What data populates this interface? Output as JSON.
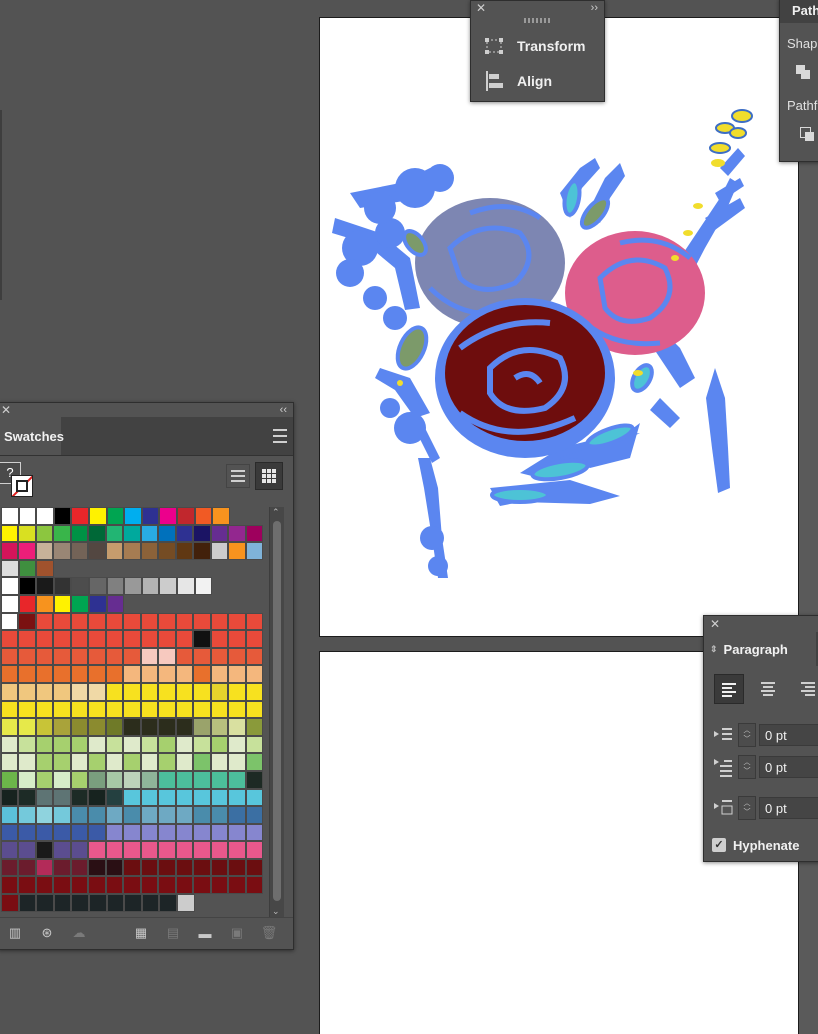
{
  "panels": {
    "transform_align": {
      "items": [
        {
          "label": "Transform",
          "icon": "transform-icon"
        },
        {
          "label": "Align",
          "icon": "align-icon"
        }
      ]
    },
    "pathfinder": {
      "tab_label": "Path",
      "shape_label": "Shap",
      "pathfinder_label": "Pathf"
    },
    "swatches": {
      "tab_label": "Swatches",
      "help_label": "?",
      "views": [
        "list-view",
        "grid-view"
      ],
      "colors": {
        "accent_selected": "#ffffff",
        "panel_bg": "#535353"
      }
    },
    "paragraph": {
      "tab_label": "Paragraph",
      "alignments": [
        "align-left",
        "align-center",
        "align-right"
      ],
      "fields": [
        {
          "name": "left-indent",
          "value": "0 pt"
        },
        {
          "name": "first-line-indent",
          "value": "0 pt"
        },
        {
          "name": "space-before",
          "value": "0 pt"
        }
      ],
      "hyphenate_label": "Hyphenate",
      "hyphenate_checked": true
    }
  },
  "artwork": {
    "palette": {
      "blue": "#5b86f0",
      "lavender": "#7d86b2",
      "pink": "#dd5d8c",
      "maroon": "#6e0d0d",
      "leaf": "#7c9a6a",
      "yellow": "#f1dd2c",
      "cyan": "#4dc3d6"
    }
  },
  "swatch_rows": [
    [
      "#ffffff",
      "#ffffff",
      "#ffffff",
      "#000000",
      "#e8262a",
      "#fff200",
      "#00a551",
      "#00aeef",
      "#2e3192",
      "#ec008c",
      "#c1272d",
      "#f15a24",
      "#f7931e"
    ],
    [
      "#fff200",
      "#d9e021",
      "#8cc63f",
      "#39b54a",
      "#009245",
      "#006837",
      "#22b573",
      "#00a99d",
      "#29abe2",
      "#0071bc",
      "#2e3192",
      "#1b1464",
      "#662d91",
      "#93278f",
      "#9e005d"
    ],
    [
      "#d4145a",
      "#ed1e79",
      "#c7b299",
      "#998675",
      "#736357",
      "#534741",
      "#c69c6d",
      "#a67c52",
      "#8c6239",
      "#754c24",
      "#603813",
      "#42210b",
      "#cccccc",
      "#f7931e",
      "#7fb3d9"
    ],
    [
      "#dddddd",
      "#3f8f3f",
      "#a0522d"
    ],
    [
      "#ffffff",
      "#000000",
      "#1a1a1a",
      "#333333",
      "#4d4d4d",
      "#666666",
      "#808080",
      "#999999",
      "#b3b3b3",
      "#cccccc",
      "#e6e6e6",
      "#f2f2f2"
    ],
    [
      "#ffffff",
      "#e8262a",
      "#f7931e",
      "#fff200",
      "#00a551",
      "#2e3192",
      "#662d91"
    ],
    [
      "#ffffff",
      "#7a1111",
      "#e84a3a",
      "#e84a3a",
      "#e84a3a",
      "#e84a3a",
      "#e84a3a",
      "#e84a3a",
      "#e84a3a",
      "#e84a3a",
      "#e84a3a",
      "#e84a3a",
      "#e84a3a",
      "#e84a3a",
      "#e84a3a"
    ],
    [
      "#e84a3a",
      "#e84a3a",
      "#e84a3a",
      "#e84a3a",
      "#e84a3a",
      "#e84a3a",
      "#e84a3a",
      "#e84a3a",
      "#e84a3a",
      "#e84a3a",
      "#e84a3a",
      "#111111",
      "#e84a3a",
      "#e84a3a",
      "#e84a3a"
    ],
    [
      "#e65a3a",
      "#e65a3a",
      "#e65a3a",
      "#e65a3a",
      "#e65a3a",
      "#e65a3a",
      "#e65a3a",
      "#e65a3a",
      "#f7c9bf",
      "#f7c9bf",
      "#e65a3a",
      "#e65a3a",
      "#e65a3a",
      "#e65a3a",
      "#e65a3a"
    ],
    [
      "#e8702c",
      "#e8702c",
      "#e8702c",
      "#e8702c",
      "#e8702c",
      "#e8702c",
      "#e8702c",
      "#f4b77d",
      "#f4b77d",
      "#f4b77d",
      "#f4b77d",
      "#e8702c",
      "#f4b77d",
      "#f4b77d",
      "#f4b77d"
    ],
    [
      "#f0c77e",
      "#f0c77e",
      "#f0c77e",
      "#f0c77e",
      "#f0d9a6",
      "#f0d9a6",
      "#f7e11f",
      "#f7e11f",
      "#f7e11f",
      "#f7e11f",
      "#f7e11f",
      "#f7e11f",
      "#e6d32c",
      "#f7e11f",
      "#f7e11f"
    ],
    [
      "#f7e11f",
      "#f7e11f",
      "#f7e11f",
      "#f7e11f",
      "#f7e11f",
      "#f7e11f",
      "#f7e11f",
      "#f7e11f",
      "#f7e11f",
      "#f7e11f",
      "#f7e11f",
      "#f7e11f",
      "#f7e11f",
      "#f7e11f",
      "#f7e11f"
    ],
    [
      "#e6e94a",
      "#e6e94a",
      "#c8c437",
      "#a9a33a",
      "#8b8b2f",
      "#8b8b2f",
      "#6f7a28",
      "#2c2d1c",
      "#2c2d1c",
      "#2c2d1c",
      "#2c2d1c",
      "#9aa36b",
      "#b8c07e",
      "#d9e0a0",
      "#8a9a3a"
    ],
    [
      "#dfeacb",
      "#c7e19b",
      "#a6d06e",
      "#a6d06e",
      "#a6d06e",
      "#dfeacb",
      "#c7e19b",
      "#dfeacb",
      "#c7e19b",
      "#a6d06e",
      "#dfeacb",
      "#c7e19b",
      "#a6d06e",
      "#dfeacb",
      "#c7e19b"
    ],
    [
      "#dfeacb",
      "#dfeacb",
      "#a6d06e",
      "#a6d06e",
      "#dfeacb",
      "#a6d06e",
      "#dfeacb",
      "#a6d06e",
      "#dfeacb",
      "#a6d06e",
      "#dfeacb",
      "#7cc36a",
      "#dfeacb",
      "#dfeacb",
      "#7cc36a"
    ],
    [
      "#6cb54a",
      "#d6ecc8",
      "#a6d06e",
      "#d6ecc8",
      "#a6d06e",
      "#7a9e7e",
      "#a7c8a6",
      "#bcd3b9",
      "#8fb59a",
      "#4cbe9b",
      "#4cbe9b",
      "#4cbe9b",
      "#4cbe9b",
      "#4cbe9b",
      "#1d2a24"
    ],
    [
      "#17231f",
      "#1d2b26",
      "#5e7474",
      "#5e7474",
      "#1d2b26",
      "#17231f",
      "#244040",
      "#58c6dc",
      "#58c6dc",
      "#58c6dc",
      "#58c6dc",
      "#58c6dc",
      "#58c6dc",
      "#58c6dc",
      "#58c6dc"
    ],
    [
      "#5bc1da",
      "#74c9db",
      "#8fd3de",
      "#74c9db",
      "#4a8cab",
      "#4a8cab",
      "#6ea9c3",
      "#4a8cab",
      "#6ea9c3",
      "#6ea9c3",
      "#6ea9c3",
      "#4a8cab",
      "#4a8cab",
      "#3b6fa3",
      "#3b6fa3"
    ],
    [
      "#3b5aa7",
      "#3b5aa7",
      "#3b5aa7",
      "#3b5aa7",
      "#3b5aa7",
      "#3b5aa7",
      "#8686cf",
      "#8686cf",
      "#8686cf",
      "#8686cf",
      "#8686cf",
      "#8686cf",
      "#8686cf",
      "#8686cf",
      "#8686cf"
    ],
    [
      "#5b4d8f",
      "#5b4d8f",
      "#1a1a1a",
      "#5b4d8f",
      "#5b4d8f",
      "#e8588c",
      "#e8588c",
      "#e8588c",
      "#e8588c",
      "#e8588c",
      "#e8588c",
      "#e8588c",
      "#e8588c",
      "#e8588c",
      "#e8588c"
    ],
    [
      "#6b1c2d",
      "#6b1c2d",
      "#b32b59",
      "#6b1c2d",
      "#6b1c2d",
      "#2a0f14",
      "#2a0f14",
      "#6b0e10",
      "#6b0e10",
      "#6b0e10",
      "#6b0e10",
      "#6b0e10",
      "#6b0e10",
      "#6b0e10",
      "#6b0e10"
    ],
    [
      "#7a0d12",
      "#7a0d12",
      "#7a0d12",
      "#7a0d12",
      "#7a0d12",
      "#7a0d12",
      "#7a0d12",
      "#7a0d12",
      "#7a0d12",
      "#7a0d12",
      "#7a0d12",
      "#7a0d12",
      "#7a0d12",
      "#7a0d12",
      "#7a0d12"
    ],
    [
      "#7a0d12",
      "#1d2527",
      "#1d2527",
      "#1d2527",
      "#1d2527",
      "#1d2527",
      "#1d2527",
      "#1d2527",
      "#1d2527",
      "#1d2527",
      "#cccccc"
    ]
  ]
}
